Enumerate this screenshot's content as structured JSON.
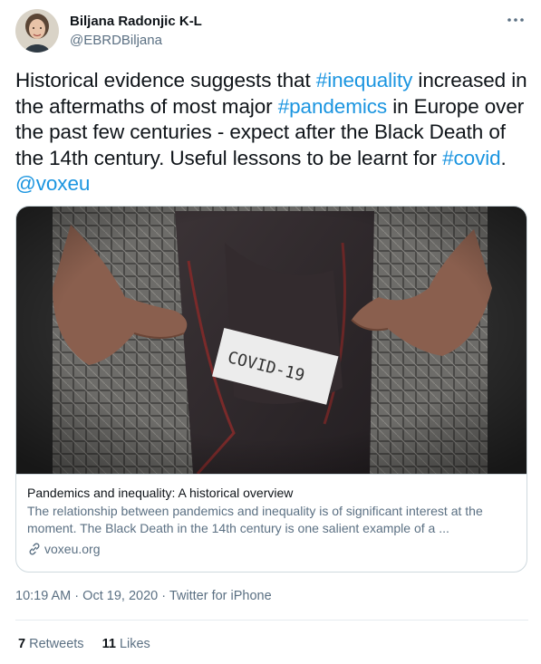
{
  "author": {
    "name": "Biljana Radonjic K-L",
    "handle": "@EBRDBiljana"
  },
  "tweet": {
    "segments": [
      {
        "text": "Historical evidence suggests that ",
        "link": false
      },
      {
        "text": "#inequality",
        "link": true
      },
      {
        "text": " increased in the aftermaths of most major ",
        "link": false
      },
      {
        "text": "#pandemics",
        "link": true
      },
      {
        "text": " in Europe over the past few centuries - expect after the Black Death of the 14th century. Useful lessons to be learnt for ",
        "link": false
      },
      {
        "text": "#covid",
        "link": true
      },
      {
        "text": ". ",
        "link": false
      },
      {
        "text": "@voxeu",
        "link": true
      }
    ]
  },
  "card": {
    "image_note": "COVID-19",
    "title": "Pandemics and inequality: A historical overview",
    "description": "The relationship between pandemics and inequality is of significant interest at the moment. The Black Death in the 14th century is one salient example of a ...",
    "domain": "voxeu.org"
  },
  "meta": {
    "time": "10:19 AM",
    "date": "Oct 19, 2020",
    "separator": "·",
    "client": "Twitter for iPhone"
  },
  "stats": {
    "retweets_count": "7",
    "retweets_label": "Retweets",
    "likes_count": "11",
    "likes_label": "Likes"
  },
  "colors": {
    "link": "#1b95e0",
    "secondary_text": "#5b7083",
    "border": "#cfd9de"
  },
  "icons": [
    "more-options-icon",
    "link-icon"
  ]
}
